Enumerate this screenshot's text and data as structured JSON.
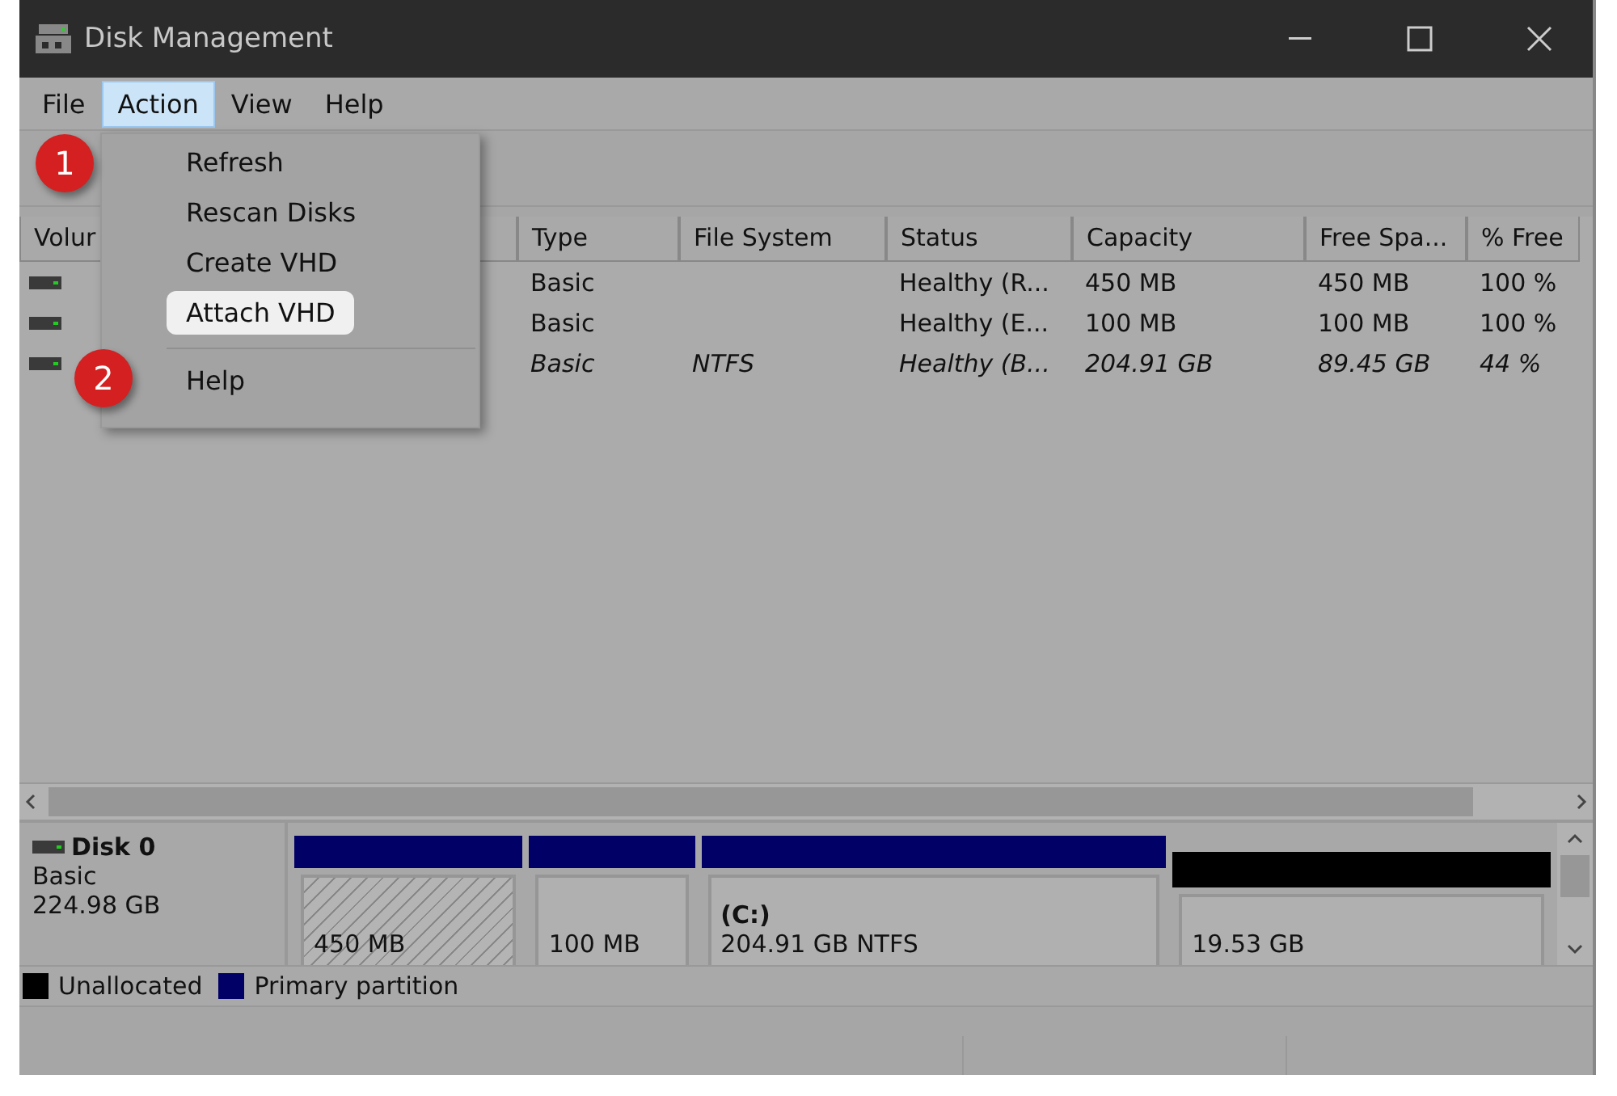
{
  "window": {
    "title": "Disk Management"
  },
  "menu_bar": [
    {
      "label": "File",
      "selected": false
    },
    {
      "label": "Action",
      "selected": true
    },
    {
      "label": "View",
      "selected": false
    },
    {
      "label": "Help",
      "selected": false
    }
  ],
  "action_menu": [
    {
      "label": "Refresh",
      "highlighted": false,
      "separator_before": false
    },
    {
      "label": "Rescan Disks",
      "highlighted": false,
      "separator_before": false
    },
    {
      "label": "Create VHD",
      "highlighted": false,
      "separator_before": false
    },
    {
      "label": "Attach VHD",
      "highlighted": true,
      "separator_before": false
    },
    {
      "label": "Help",
      "highlighted": false,
      "separator_before": true
    }
  ],
  "step_badges": [
    "1",
    "2"
  ],
  "table": {
    "columns": [
      "Volur",
      "Type",
      "File System",
      "Status",
      "Capacity",
      "Free Spa...",
      "% Free"
    ],
    "rows": [
      {
        "type": "Basic",
        "status": "Healthy (R...",
        "capacity": "450 MB",
        "free_space": "450 MB",
        "percent_free": "100 %",
        "italic": false
      },
      {
        "type": "Basic",
        "status": "Healthy (E...",
        "capacity": "100 MB",
        "free_space": "100 MB",
        "percent_free": "100 %",
        "italic": false
      },
      {
        "type": "Basic",
        "file_system": "NTFS",
        "status": "Healthy (B...",
        "capacity": "204.91 GB",
        "free_space": "89.45 GB",
        "percent_free": "44 %",
        "italic": true
      }
    ]
  },
  "disk": {
    "name": "Disk 0",
    "type": "Basic",
    "size": "224.98 GB",
    "partitions": [
      {
        "kind": "primary",
        "size": "450 MB",
        "hatched": true
      },
      {
        "kind": "primary",
        "size": "100 MB",
        "hatched": false
      },
      {
        "kind": "primary",
        "name": "(C:)",
        "size": "204.91 GB NTFS",
        "hatched": false
      },
      {
        "kind": "unallocated",
        "size": "19.53 GB",
        "hatched": false
      }
    ]
  },
  "legend": [
    {
      "label": "Unallocated",
      "color": "#000000"
    },
    {
      "label": "Primary partition",
      "color": "#000066"
    }
  ]
}
